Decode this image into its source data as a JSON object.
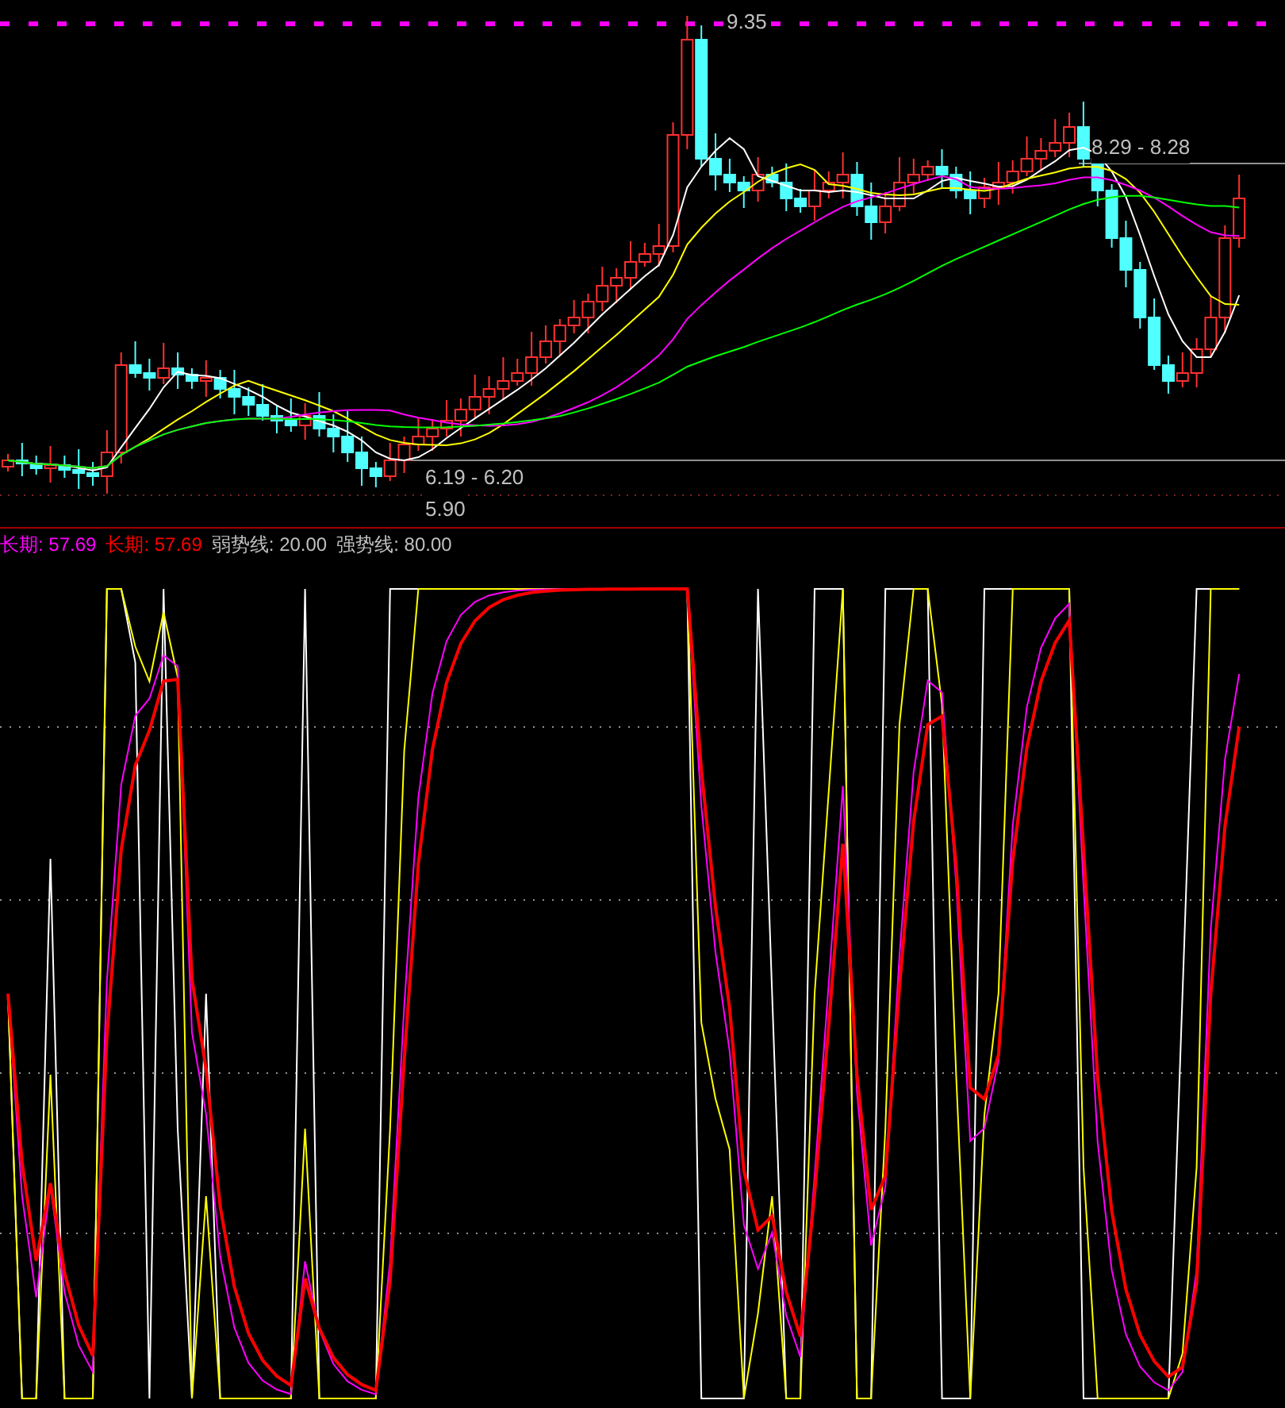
{
  "price_panel": {
    "labels": [
      {
        "text": "9.35"
      },
      {
        "text": "8.29 - 8.28"
      },
      {
        "text": "6.19 - 6.20"
      },
      {
        "text": "5.90"
      }
    ]
  },
  "indicator_panel": {
    "legend": [
      {
        "text": "长期: 57.69",
        "color": "#ff00ff"
      },
      {
        "text": "长期: 57.69",
        "color": "#ff0000"
      },
      {
        "text": "弱势线: 20.00",
        "color": "#c0c0c0"
      },
      {
        "text": "强势线: 80.00",
        "color": "#c0c0c0"
      }
    ]
  }
}
